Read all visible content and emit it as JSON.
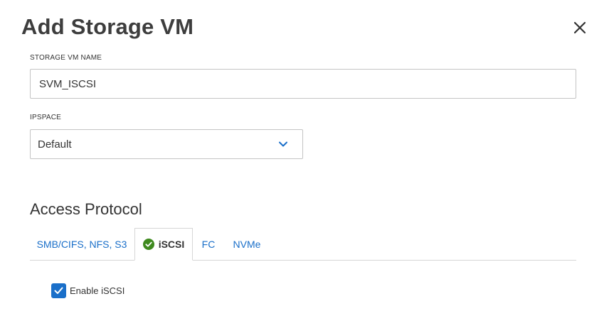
{
  "dialog": {
    "title": "Add Storage VM"
  },
  "svm_name": {
    "label": "STORAGE VM NAME",
    "value": "SVM_ISCSI"
  },
  "ipspace": {
    "label": "IPSPACE",
    "selected": "Default"
  },
  "access_protocol": {
    "title": "Access Protocol",
    "tabs": [
      {
        "label": "SMB/CIFS, NFS, S3",
        "active": false
      },
      {
        "label": "iSCSI",
        "active": true,
        "status_icon": "check-circle-icon"
      },
      {
        "label": "FC",
        "active": false
      },
      {
        "label": "NVMe",
        "active": false
      }
    ]
  },
  "iscsi": {
    "enable_label": "Enable iSCSI",
    "enabled": true
  },
  "colors": {
    "accent": "#1a6fc9",
    "success": "#3f8a1f"
  }
}
